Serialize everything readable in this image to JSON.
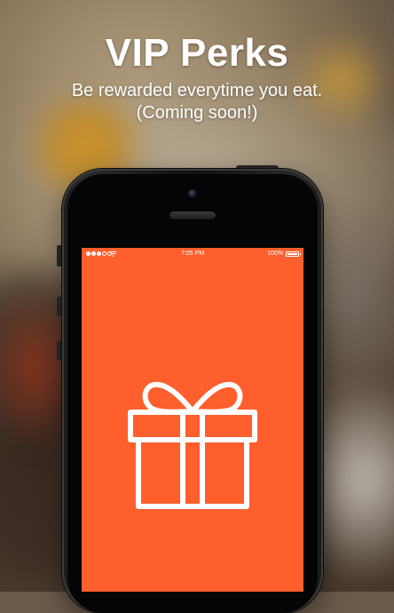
{
  "header": {
    "title": "VIP Perks",
    "subtitle_line1": "Be rewarded everytime you eat.",
    "subtitle_line2": "(Coming soon!)"
  },
  "statusbar": {
    "time": "7:05 PM",
    "battery_text": "100%",
    "battery_level": 1.0,
    "signal_bars": 3,
    "signal_total": 5
  },
  "screen": {
    "background_color": "#ff5f2d",
    "icon": "gift-icon"
  },
  "colors": {
    "accent": "#ff5f2d",
    "text": "#ffffff"
  }
}
